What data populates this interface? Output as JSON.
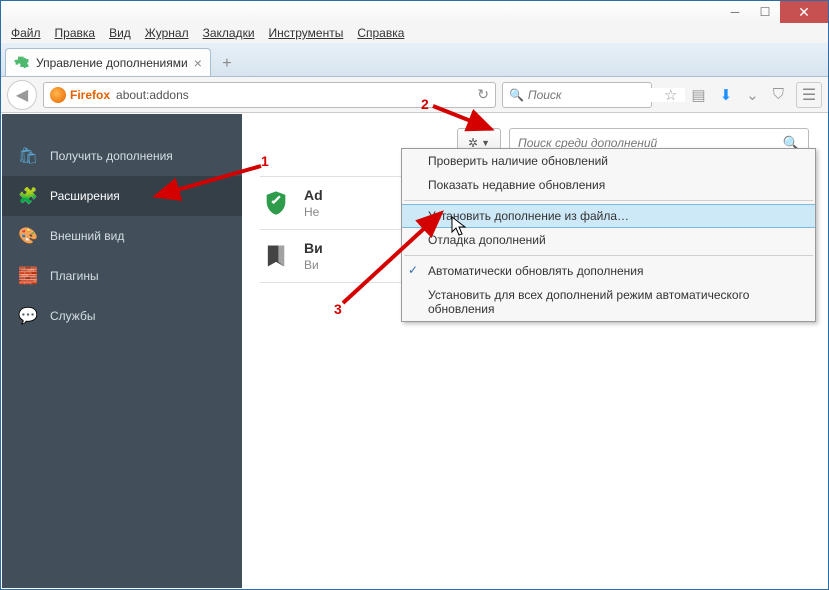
{
  "menubar": [
    "Файл",
    "Правка",
    "Вид",
    "Журнал",
    "Закладки",
    "Инструменты",
    "Справка"
  ],
  "tab": {
    "title": "Управление дополнениями"
  },
  "urlbar": {
    "identity": "Firefox",
    "url": "about:addons",
    "search_placeholder": "Поиск"
  },
  "sidebar": {
    "items": [
      {
        "label": "Получить дополнения",
        "icon": "🛍",
        "color": "#5aa6d0"
      },
      {
        "label": "Расширения",
        "icon": "🧩",
        "color": "#4fba6f",
        "active": true
      },
      {
        "label": "Внешний вид",
        "icon": "🎨",
        "color": "#d07ad0"
      },
      {
        "label": "Плагины",
        "icon": "🧱",
        "color": "#4a90d9"
      },
      {
        "label": "Службы",
        "icon": "💬",
        "color": "#6aa2d8"
      }
    ]
  },
  "addon_toolbar": {
    "search_placeholder": "Поиск среди дополнений"
  },
  "addons": [
    {
      "name": "Ad",
      "desc": "Не",
      "icon": "shield",
      "color": "#2e9c4a"
    },
    {
      "name": "Ви",
      "desc": "Ви",
      "icon": "bookmark",
      "color": "#555"
    }
  ],
  "gear_menu": {
    "items": [
      {
        "label": "Проверить наличие обновлений"
      },
      {
        "label": "Показать недавние обновления"
      },
      {
        "sep": true
      },
      {
        "label": "Установить дополнение из файла…",
        "hover": true
      },
      {
        "label": "Отладка дополнений"
      },
      {
        "sep": true
      },
      {
        "label": "Автоматически обновлять дополнения",
        "checked": true
      },
      {
        "label": "Установить для всех дополнений режим автоматического обновления"
      }
    ]
  },
  "annotations": {
    "n1": "1",
    "n2": "2",
    "n3": "3"
  }
}
